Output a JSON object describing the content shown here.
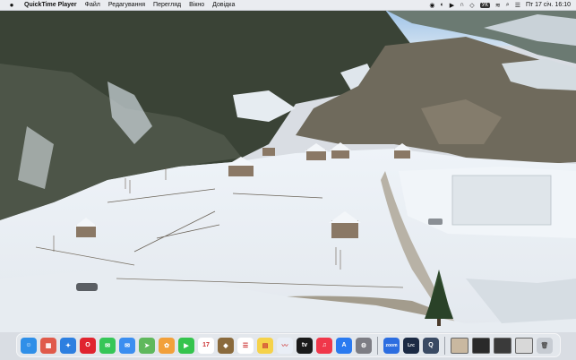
{
  "menubar": {
    "app_name": "QuickTime Player",
    "menus": [
      "Файл",
      "Редагування",
      "Перегляд",
      "Вікно",
      "Довідка"
    ],
    "keyboard": "УК",
    "datetime": "Пт 17 січ. 16:10"
  },
  "dock": {
    "items": [
      {
        "name": "finder",
        "glyph": "☺",
        "color": "#2f8fe8"
      },
      {
        "name": "launchpad",
        "glyph": "▦",
        "color": "#e05a4a"
      },
      {
        "name": "safari",
        "glyph": "✦",
        "color": "#2d7fe0"
      },
      {
        "name": "opera",
        "glyph": "O",
        "color": "#e0242f"
      },
      {
        "name": "messages",
        "glyph": "✉",
        "color": "#36c657"
      },
      {
        "name": "mail",
        "glyph": "✉",
        "color": "#3b8ef0"
      },
      {
        "name": "maps",
        "glyph": "➤",
        "color": "#5fb85c"
      },
      {
        "name": "photos",
        "glyph": "✿",
        "color": "#f2a03a"
      },
      {
        "name": "facetime",
        "glyph": "▶",
        "color": "#35c44d"
      },
      {
        "name": "calendar",
        "glyph": "17",
        "color": "#ffffff"
      },
      {
        "name": "tape",
        "glyph": "◆",
        "color": "#8a6a3c"
      },
      {
        "name": "reminders",
        "glyph": "☰",
        "color": "#ffffff"
      },
      {
        "name": "notes",
        "glyph": "▤",
        "color": "#f5d24a"
      },
      {
        "name": "freeform",
        "glyph": "〰",
        "color": "#e9eef6"
      },
      {
        "name": "apple-tv",
        "glyph": "tv",
        "color": "#1a1a1a"
      },
      {
        "name": "music",
        "glyph": "♫",
        "color": "#f0374a"
      },
      {
        "name": "app-store",
        "glyph": "A",
        "color": "#2a7af0"
      },
      {
        "name": "system-settings",
        "glyph": "⚙",
        "color": "#7d7d84"
      },
      {
        "name": "zoom",
        "glyph": "zoom",
        "color": "#2c6de0"
      },
      {
        "name": "lightroom",
        "glyph": "Lrc",
        "color": "#1c2a44"
      },
      {
        "name": "quicktime",
        "glyph": "Q",
        "color": "#3a4a63"
      }
    ],
    "calendar_month": "СІЧ.",
    "calendar_day": "17"
  }
}
